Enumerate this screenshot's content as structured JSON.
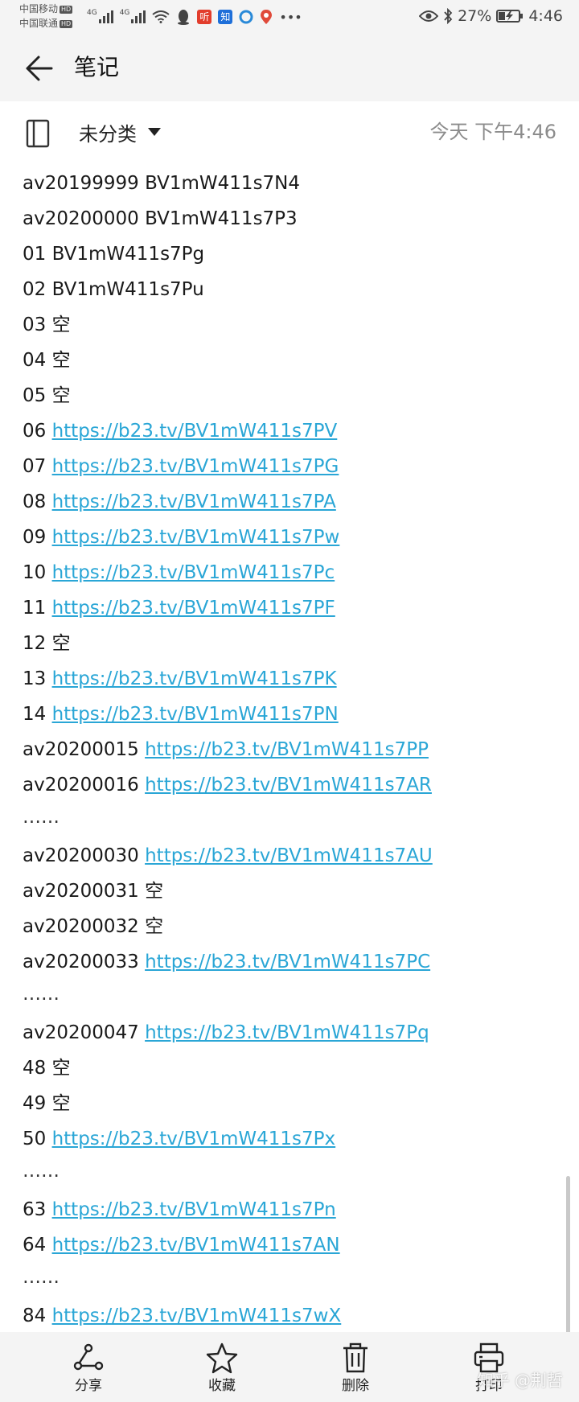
{
  "status_bar": {
    "carrier1": "中国移动",
    "carrier2": "中国联通",
    "hd_label": "HD",
    "network": "4G",
    "battery": "27%",
    "time": "4:46",
    "app_badges": [
      {
        "name": "listen-app-icon",
        "glyph": "听",
        "color": "#e23d2c"
      },
      {
        "name": "zhihu-app-icon",
        "glyph": "知",
        "color": "#1e6fd9"
      }
    ]
  },
  "header": {
    "title": "笔记"
  },
  "note": {
    "category": "未分类",
    "timestamp": "今天 下午4:46",
    "lines": [
      {
        "prefix": "av20199999 BV1mW411s7N4",
        "link": ""
      },
      {
        "prefix": "av20200000 BV1mW411s7P3",
        "link": ""
      },
      {
        "prefix": "01 BV1mW411s7Pg",
        "link": ""
      },
      {
        "prefix": "02 BV1mW411s7Pu",
        "link": ""
      },
      {
        "prefix": "03 空",
        "link": ""
      },
      {
        "prefix": "04 空",
        "link": ""
      },
      {
        "prefix": "05 空",
        "link": ""
      },
      {
        "prefix": "06 ",
        "link": "https://b23.tv/BV1mW411s7PV"
      },
      {
        "prefix": "07 ",
        "link": "https://b23.tv/BV1mW411s7PG"
      },
      {
        "prefix": "08 ",
        "link": "https://b23.tv/BV1mW411s7PA"
      },
      {
        "prefix": "09 ",
        "link": "https://b23.tv/BV1mW411s7Pw"
      },
      {
        "prefix": "10 ",
        "link": "https://b23.tv/BV1mW411s7Pc"
      },
      {
        "prefix": "11 ",
        "link": "https://b23.tv/BV1mW411s7PF"
      },
      {
        "prefix": "12 空",
        "link": ""
      },
      {
        "prefix": "13 ",
        "link": "https://b23.tv/BV1mW411s7PK"
      },
      {
        "prefix": "14 ",
        "link": "https://b23.tv/BV1mW411s7PN"
      },
      {
        "prefix": "av20200015 ",
        "link": "https://b23.tv/BV1mW411s7PP"
      },
      {
        "prefix": "av20200016 ",
        "link": "https://b23.tv/BV1mW411s7AR"
      },
      {
        "prefix": "……",
        "link": "",
        "dots": true
      },
      {
        "prefix": "av20200030 ",
        "link": "https://b23.tv/BV1mW411s7AU"
      },
      {
        "prefix": "av20200031 空",
        "link": ""
      },
      {
        "prefix": "av20200032 空",
        "link": ""
      },
      {
        "prefix": "av20200033 ",
        "link": "https://b23.tv/BV1mW411s7PC"
      },
      {
        "prefix": "……",
        "link": "",
        "dots": true
      },
      {
        "prefix": "av20200047 ",
        "link": "https://b23.tv/BV1mW411s7Pq"
      },
      {
        "prefix": "48 空",
        "link": ""
      },
      {
        "prefix": "49 空",
        "link": ""
      },
      {
        "prefix": "50 ",
        "link": "https://b23.tv/BV1mW411s7Px"
      },
      {
        "prefix": "……",
        "link": "",
        "dots": true
      },
      {
        "prefix": "63 ",
        "link": "https://b23.tv/BV1mW411s7Pn"
      },
      {
        "prefix": "64 ",
        "link": "https://b23.tv/BV1mW411s7AN"
      },
      {
        "prefix": "……",
        "link": "",
        "dots": true
      },
      {
        "prefix": "84 ",
        "link": "https://b23.tv/BV1mW411s7wX"
      }
    ]
  },
  "toolbar": {
    "share_label": "分享",
    "favorite_label": "收藏",
    "delete_label": "删除",
    "print_label": "打印"
  },
  "watermark": "知乎 @荆哲",
  "colors": {
    "link": "#2aa6d6",
    "background": "#f4f4f4",
    "content": "#ffffff"
  }
}
